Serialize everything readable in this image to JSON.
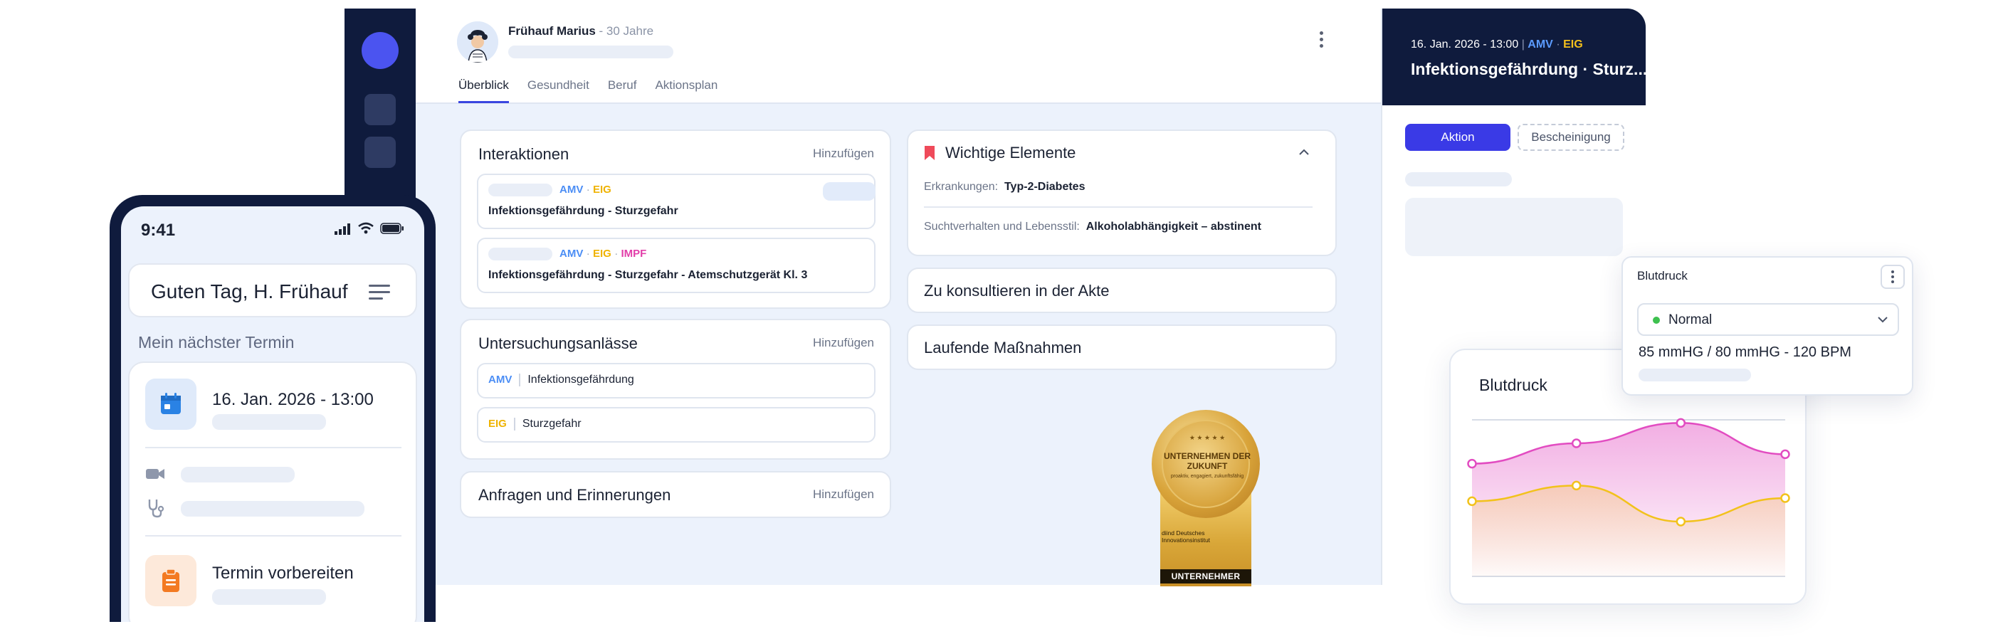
{
  "patient": {
    "name": "Frühauf Marius",
    "age": "- 30 Jahre"
  },
  "tabs": [
    "Überblick",
    "Gesundheit",
    "Beruf",
    "Aktionsplan"
  ],
  "interaktionen": {
    "title": "Interaktionen",
    "action": "Hinzufügen",
    "items": [
      {
        "tags": [
          "AMV",
          "EIG"
        ],
        "text": "Infektionsgefährdung - Sturzgefahr"
      },
      {
        "tags": [
          "AMV",
          "EIG",
          "IMPF"
        ],
        "text": "Infektionsgefährdung - Sturzgefahr - Atemschutzgerät Kl. 3"
      }
    ]
  },
  "untersuchung": {
    "title": "Untersuchungsanlässe",
    "action": "Hinzufügen",
    "items": [
      {
        "tag": "AMV",
        "text": "Infektionsgefährdung"
      },
      {
        "tag": "EIG",
        "text": "Sturzgefahr"
      }
    ]
  },
  "anfragen": {
    "title": "Anfragen und Erinnerungen",
    "action": "Hinzufügen"
  },
  "wichtige": {
    "title": "Wichtige Elemente",
    "rows": [
      {
        "label": "Erkrankungen:",
        "value": "Typ-2-Diabetes"
      },
      {
        "label": "Suchtverhalten und Lebensstil:",
        "value": "Alkoholabhängigkeit – abstinent"
      }
    ]
  },
  "akte": {
    "title": "Zu konsultieren in der Akte"
  },
  "massnahmen": {
    "title": "Laufende Maßnahmen"
  },
  "right_panel": {
    "date": "16. Jan. 2026 - 13:00",
    "tag_amv": "AMV",
    "tag_eig": "EIG",
    "title": "Infektionsgefährdung · Sturz...",
    "btn_aktion": "Aktion",
    "btn_bescheinigung": "Bescheinigung"
  },
  "popup": {
    "title": "Blutdruck",
    "status": "Normal",
    "status_color": "#3ec14f",
    "reading": "85 mmHG  /  80 mmHG  -  120 BPM"
  },
  "chart_data": {
    "type": "area",
    "title": "Blutdruck",
    "x": [
      0,
      1,
      2,
      3
    ],
    "series": [
      {
        "values": [
          0.72,
          0.85,
          0.98,
          0.78
        ],
        "color": "#e24cc1"
      },
      {
        "values": [
          0.48,
          0.58,
          0.35,
          0.5
        ],
        "color": "#f2c21b"
      }
    ],
    "grid": true
  },
  "mobile": {
    "time": "9:41",
    "greeting": "Guten Tag, H. Frühauf",
    "next_label": "Mein nächster Termin",
    "appt_date": "16. Jan. 2026 - 13:00",
    "prep": "Termin vorbereiten"
  },
  "badge": {
    "line1": "UNTERNEHMEN DER ZUKUNFT",
    "line2": "proaktiv, engagiert, zukunftsfähig",
    "institute": "diind Deutsches Innovationsinstitut",
    "footer": "UNTERNEHMER"
  }
}
